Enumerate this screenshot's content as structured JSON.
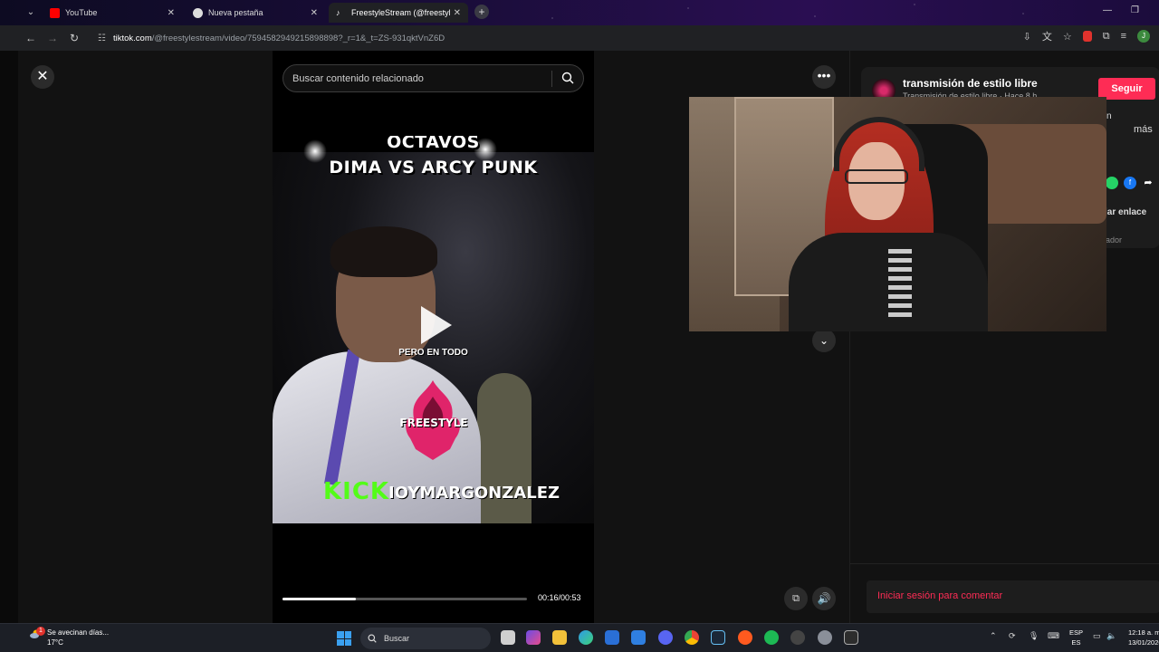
{
  "browser": {
    "tabs": [
      {
        "title": "YouTube",
        "favicon": "youtube-icon",
        "color": "#ff0000",
        "active": false
      },
      {
        "title": "Nueva pestaña",
        "favicon": "chrome-icon",
        "color": "#dddddd",
        "active": false
      },
      {
        "title": "FreestyleStream (@freestylestre",
        "favicon": "tiktok-icon",
        "color": "#ffffff",
        "active": true
      }
    ],
    "url_host": "tiktok.com",
    "url_path": "/@freestylestream/video/7594582949215898898?_r=1&_t=ZS-931qktVnZ6D",
    "profile_initial": "J"
  },
  "player": {
    "search_placeholder": "Buscar contenido relacionado",
    "video_title_line1": "OCTAVOS",
    "video_title_line2": "DIMA VS ARCY PUNK",
    "caption": "PERO EN TODO",
    "logo_text": "FREESTYLE",
    "kick_text": "KICK",
    "handle_text": "IOYMARGONZALEZ",
    "time": "00:16/00:53",
    "progress_fraction": 0.3
  },
  "panel": {
    "creator_name": "transmisión de estilo libre",
    "creator_sub": "Transmisión de estilo libre · Hace 8 h",
    "follow_label": "Seguir",
    "peek_m": "n",
    "peek_mas": "más",
    "copy_link": "iar enlace",
    "peek_ador": "ador",
    "comment_prompt": "Iniciar sesión para comentar",
    "accent": "#fe2c55"
  },
  "taskbar": {
    "weather_title": "Se avecinan días...",
    "weather_temp": "17°C",
    "weather_badge": "1",
    "search_label": "Buscar",
    "lang_top": "ESP",
    "lang_bottom": "ES",
    "time": "12:18 a. m.",
    "date": "13/01/2026"
  }
}
